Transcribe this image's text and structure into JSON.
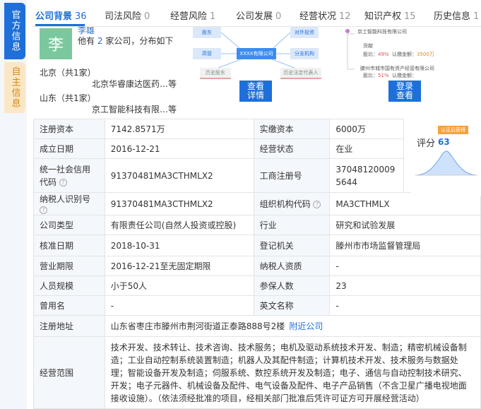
{
  "side_tabs": [
    "官方信息",
    "自主信息"
  ],
  "tabs": [
    {
      "label": "公司背景",
      "count": "36"
    },
    {
      "label": "司法风险",
      "count": "0"
    },
    {
      "label": "经营风险",
      "count": "1"
    },
    {
      "label": "公司发展",
      "count": "0"
    },
    {
      "label": "经营状况",
      "count": "12"
    },
    {
      "label": "知识产权",
      "count": "15"
    },
    {
      "label": "历史信息",
      "count": "1"
    }
  ],
  "holder": {
    "avatar_char": "李",
    "name": "李雄",
    "desc_pre": "他有",
    "desc_num": "2",
    "desc_post": "家公司，分布如下"
  },
  "regions": [
    {
      "label": "北京（共1家）",
      "company": "北京华睿康达医药…等"
    },
    {
      "label": "山东（共1家）",
      "company": "京工智能科技有限…等"
    }
  ],
  "diagram": {
    "boxes": [
      "股东",
      "对外投资",
      "高管",
      "XXXX有限公司",
      "分支机构",
      "历史股东",
      "历史法定代表人"
    ],
    "button": "查看\n详情"
  },
  "right_preview": {
    "company_top": "京工智能科技有限公司",
    "role": "货献",
    "share_label": "股比：",
    "share": "49%",
    "capital_label": "认缴金额：",
    "capital": "3500万",
    "company_bottom": "滕州市城市国有资产经营有限公司",
    "share2_label": "股比：",
    "share2": "51%",
    "capital2_label": "认缴金额：",
    "button": "登录\n查看"
  },
  "score": {
    "label": "评分",
    "value": "63",
    "badge": "认证后获得"
  },
  "rows": [
    {
      "l1": "注册资本",
      "v1": "7142.8571万",
      "l2": "实缴资本",
      "v2": "6000万"
    },
    {
      "l1": "成立日期",
      "v1": "2016-12-21",
      "l2": "经营状态",
      "v2": "在业"
    },
    {
      "l1": "统一社会信用代码",
      "v1": "91370481MA3CTHMLX2",
      "l2": "工商注册号",
      "v2": "370481200095644"
    },
    {
      "l1": "纳税人识别号",
      "v1": "91370481MA3CTHMLX2",
      "l2": "组织机构代码",
      "v2": "MA3CTHMLX"
    },
    {
      "l1": "公司类型",
      "v1": "有限责任公司(自然人投资或控股)",
      "l2": "行业",
      "v2": "研究和试验发展"
    },
    {
      "l1": "核准日期",
      "v1": "2018-10-31",
      "l2": "登记机关",
      "v2": "滕州市市场监督管理局"
    },
    {
      "l1": "营业期限",
      "v1": "2016-12-21至无固定期限",
      "l2": "纳税人资质",
      "v2": "-"
    },
    {
      "l1": "人员规模",
      "v1": "小于50人",
      "l2": "参保人数",
      "v2": "23"
    },
    {
      "l1": "曾用名",
      "v1": "-",
      "l2": "英文名称",
      "v2": "-"
    }
  ],
  "address": {
    "label": "注册地址",
    "value": "山东省枣庄市滕州市荆河街道正泰路888号2楼",
    "link": "附近公司"
  },
  "scope": {
    "label": "经营范围",
    "value": "技术开发、技术转让、技术咨询、技术服务；电机及驱动系统技术开发、制造；精密机械设备制造；工业自动控制系统装置制造；机器人及其配件制造；计算机技术开发、技术服务与数据处理；智能设备开发及制造；伺服系统、数控系统开发及制造；电子、通信与自动控制技术研究、开发；电子元器件、机械设备及配件、电气设备及配件、电子产品销售（不含卫星广播电视地面接收设施）。（依法须经批准的项目，经相关部门批准后凭许可证方可开展经营活动）"
  }
}
